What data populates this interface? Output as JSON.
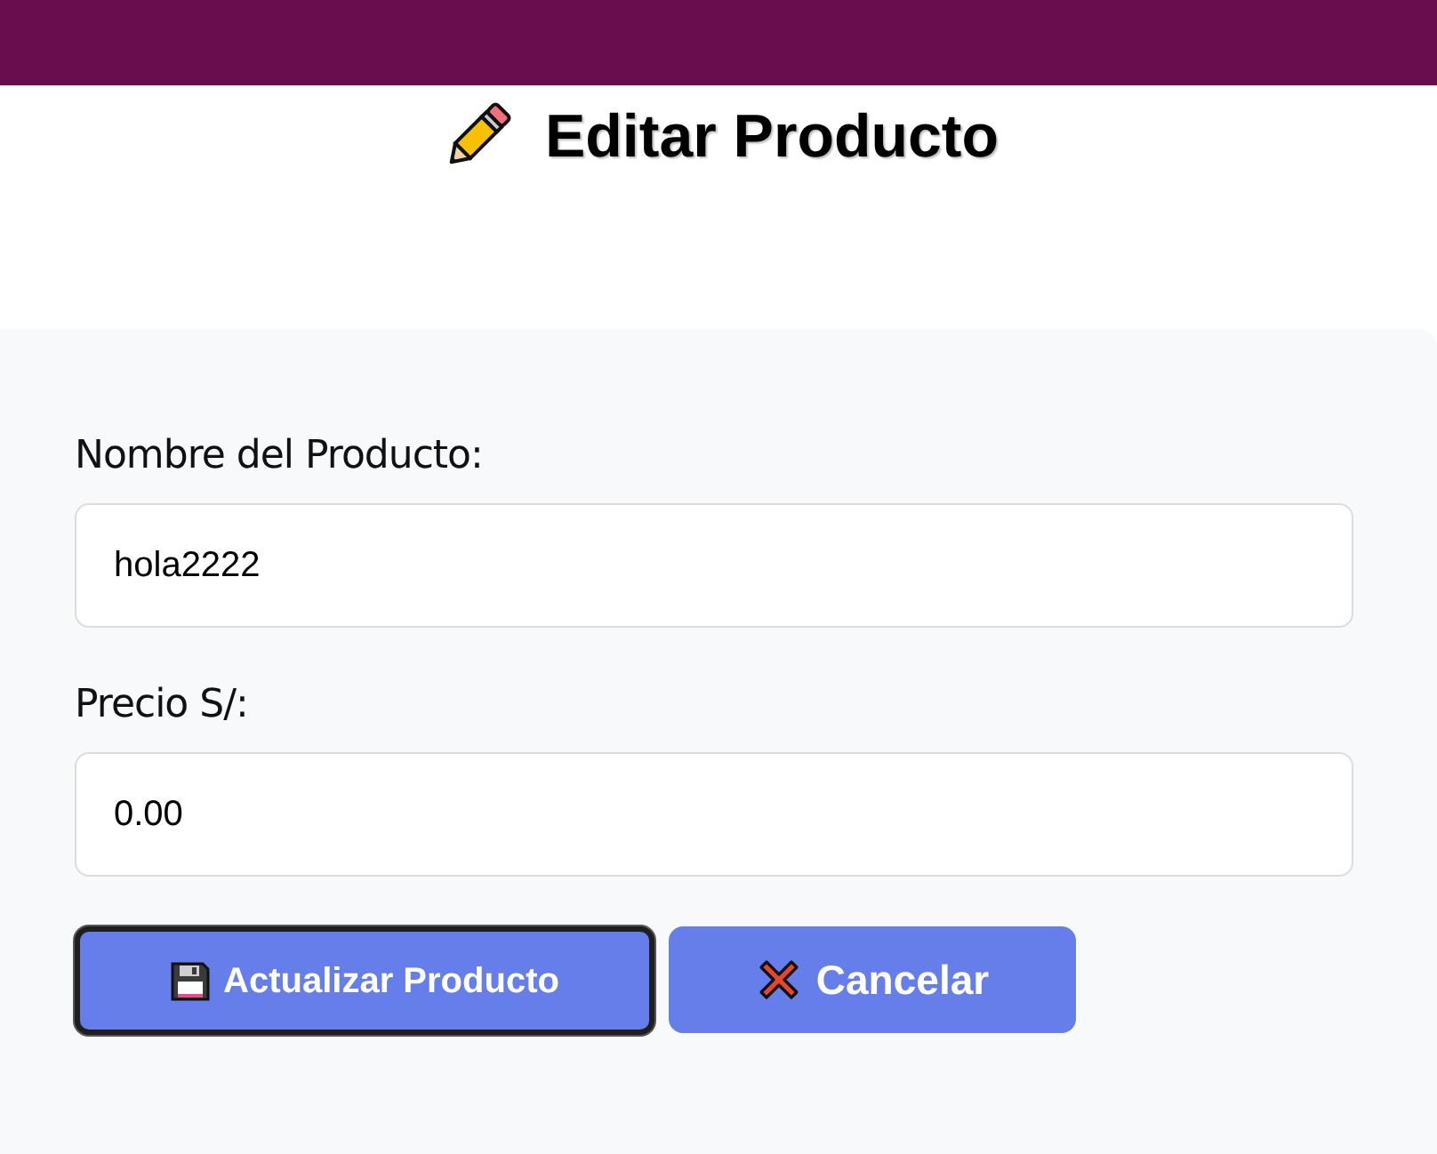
{
  "page": {
    "title": "Editar Producto"
  },
  "form": {
    "fields": [
      {
        "label": "Nombre del Producto:",
        "value": "hola2222"
      },
      {
        "label": "Precio S/:",
        "value": "0.00"
      }
    ],
    "buttons": [
      {
        "kind": "submit",
        "label": "Actualizar Producto",
        "focused": true
      },
      {
        "kind": "cancel",
        "label": "Cancelar",
        "focused": false
      }
    ]
  }
}
